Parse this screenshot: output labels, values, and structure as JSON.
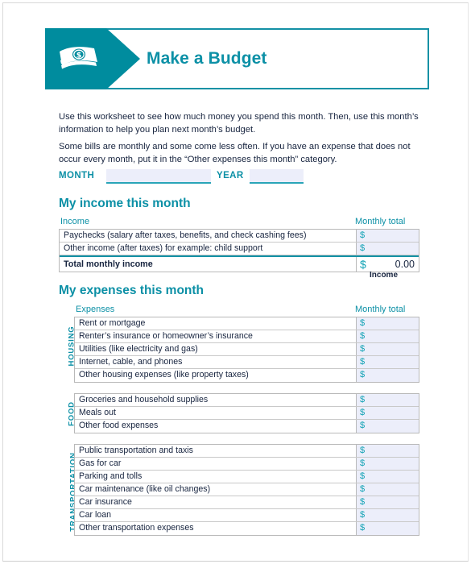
{
  "header": {
    "title": "Make a Budget",
    "icon": "money-bills-icon"
  },
  "intro": {
    "paragraph_1": "Use this worksheet to see how much money you spend this month. Then, use this month’s information to help you plan next month’s budget.",
    "paragraph_2": "Some bills are monthly and some come less often. If you have an expense that does not occur every month, put it in the “Other expenses this month” category."
  },
  "date_fields": {
    "month_label": "MONTH",
    "month_value": "",
    "year_label": "YEAR",
    "year_value": ""
  },
  "income_section": {
    "title": "My income this month",
    "col_item": "Income",
    "col_total": "Monthly total",
    "rows": [
      {
        "label": "Paychecks (salary after taxes, benefits, and check cashing fees)",
        "currency": "$",
        "value": ""
      },
      {
        "label": "Other income (after taxes) for example: child support",
        "currency": "$",
        "value": ""
      }
    ],
    "total": {
      "label": "Total monthly income",
      "currency": "$",
      "amount": "0.00",
      "caption": "Income"
    }
  },
  "expenses_section": {
    "title": "My expenses this month",
    "col_item": "Expenses",
    "col_total": "Monthly total",
    "groups": [
      {
        "name": "HOUSING",
        "rows": [
          {
            "label": "Rent or mortgage",
            "currency": "$",
            "value": ""
          },
          {
            "label": "Renter’s insurance or homeowner’s insurance",
            "currency": "$",
            "value": ""
          },
          {
            "label": "Utilities (like electricity and gas)",
            "currency": "$",
            "value": ""
          },
          {
            "label": "Internet, cable, and phones",
            "currency": "$",
            "value": ""
          },
          {
            "label": "Other housing expenses (like property taxes)",
            "currency": "$",
            "value": ""
          }
        ]
      },
      {
        "name": "FOOD",
        "rows": [
          {
            "label": "Groceries and household supplies",
            "currency": "$",
            "value": ""
          },
          {
            "label": "Meals out",
            "currency": "$",
            "value": ""
          },
          {
            "label": "Other food expenses",
            "currency": "$",
            "value": ""
          }
        ]
      },
      {
        "name": "TRANSPORTATION",
        "rows": [
          {
            "label": "Public transportation and taxis",
            "currency": "$",
            "value": ""
          },
          {
            "label": "Gas for car",
            "currency": "$",
            "value": ""
          },
          {
            "label": "Parking and tolls",
            "currency": "$",
            "value": ""
          },
          {
            "label": "Car maintenance (like oil changes)",
            "currency": "$",
            "value": ""
          },
          {
            "label": "Car insurance",
            "currency": "$",
            "value": ""
          },
          {
            "label": "Car loan",
            "currency": "$",
            "value": ""
          },
          {
            "label": "Other transportation expenses",
            "currency": "$",
            "value": ""
          }
        ]
      }
    ]
  },
  "colors": {
    "teal": "#008c9e",
    "teal_text": "#0c90a6",
    "field_fill": "#eceefa",
    "body_text": "#17243f"
  }
}
